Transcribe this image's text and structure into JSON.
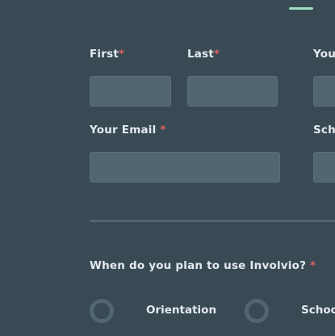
{
  "form": {
    "first_label": "First",
    "last_label": "Last",
    "your_label": "Your",
    "email_label": "Your Email",
    "school_label": "Scho",
    "required_mark": "*",
    "first_value": "",
    "last_value": "",
    "your_value": "",
    "email_value": "",
    "school_value": "",
    "question": "When do you plan to use Involvio?",
    "options": [
      "Orientation",
      "Schoo"
    ]
  },
  "colors": {
    "background": "#394a54",
    "field": "#51666f",
    "accent": "#9fe0c4",
    "required": "#e06060"
  }
}
